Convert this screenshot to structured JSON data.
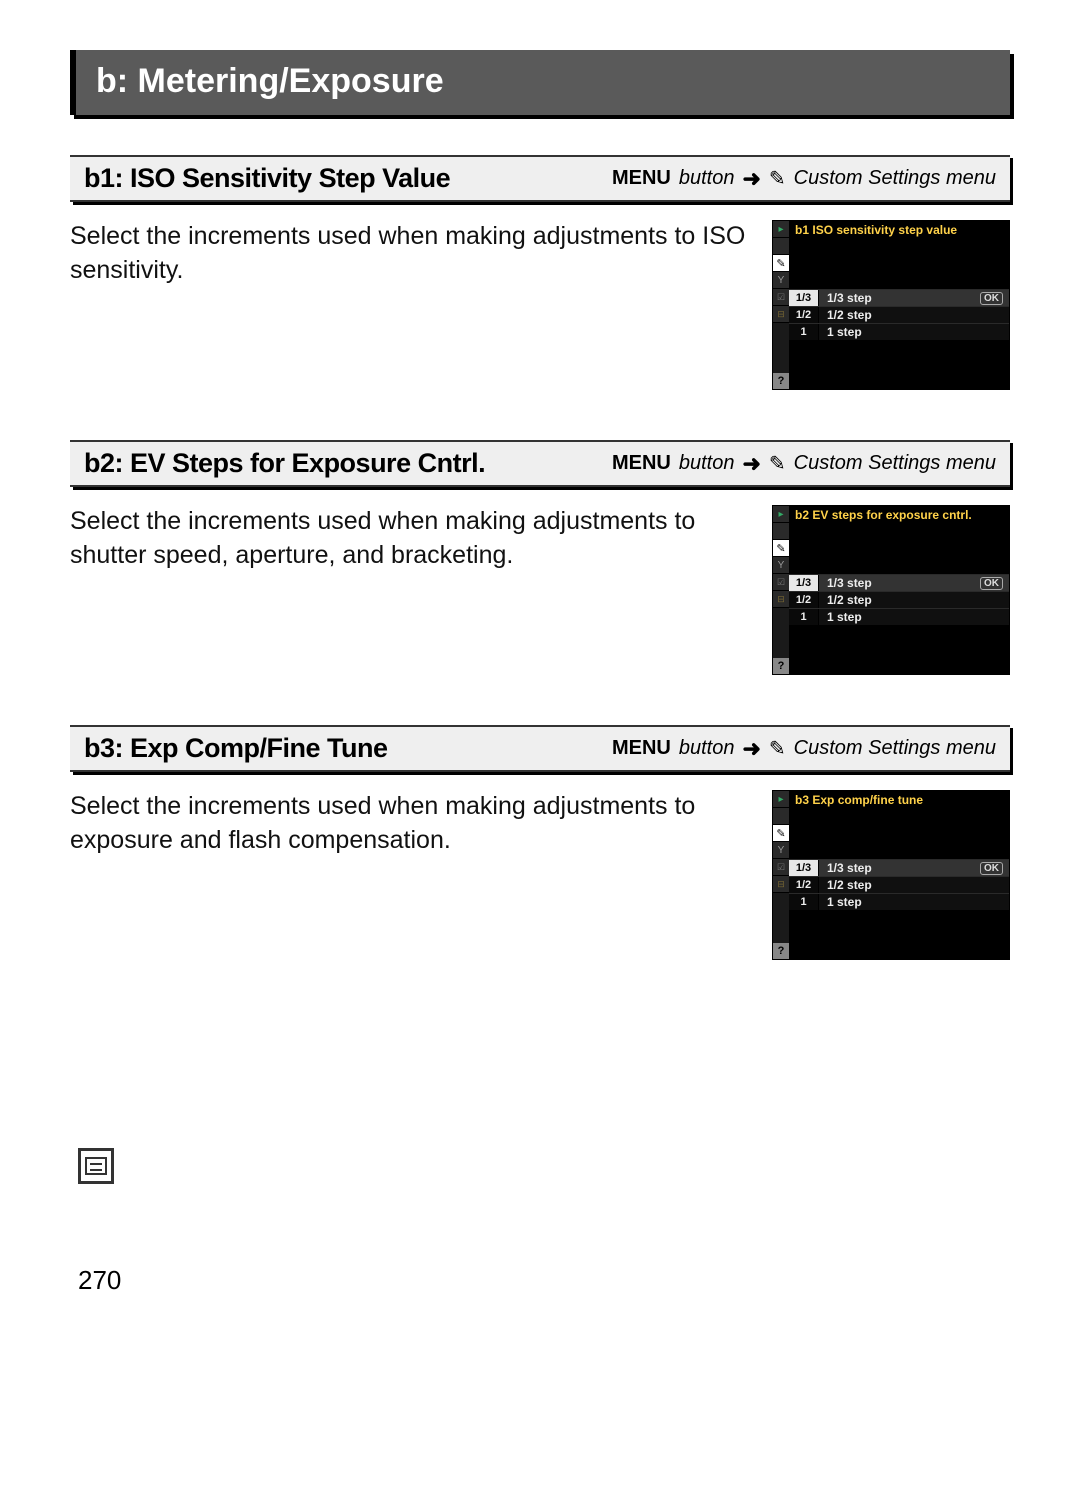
{
  "section": {
    "title": "b: Metering/Exposure"
  },
  "nav": {
    "menu": "MENU",
    "button_word": "button",
    "arrow": "➜",
    "pencil": "✎",
    "dest": "Custom Settings menu"
  },
  "items": [
    {
      "title": "b1: ISO Sensitivity Step Value",
      "desc": "Select the increments used when making adjustments to ISO sensitivity.",
      "lcd": {
        "heading_code": "b1",
        "heading_text": "ISO sensitivity step value",
        "rows": [
          {
            "frac": "1/3",
            "label": "1/3 step",
            "selected": true,
            "ok": "OK"
          },
          {
            "frac": "1/2",
            "label": "1/2 step",
            "selected": false
          },
          {
            "frac": "1",
            "label": "1 step",
            "selected": false
          }
        ]
      }
    },
    {
      "title": "b2: EV Steps for Exposure Cntrl.",
      "desc": "Select the increments used when making adjustments to shutter speed, aperture, and bracketing.",
      "lcd": {
        "heading_code": "b2",
        "heading_text": "EV steps for exposure cntrl.",
        "rows": [
          {
            "frac": "1/3",
            "label": "1/3 step",
            "selected": true,
            "ok": "OK"
          },
          {
            "frac": "1/2",
            "label": "1/2 step",
            "selected": false
          },
          {
            "frac": "1",
            "label": "1 step",
            "selected": false
          }
        ]
      }
    },
    {
      "title": "b3: Exp Comp/Fine Tune",
      "desc": "Select the increments used when making adjustments to exposure and flash compensation.",
      "lcd": {
        "heading_code": "b3",
        "heading_text": "Exp comp/fine tune",
        "rows": [
          {
            "frac": "1/3",
            "label": "1/3 step",
            "selected": true,
            "ok": "OK"
          },
          {
            "frac": "1/2",
            "label": "1/2 step",
            "selected": false
          },
          {
            "frac": "1",
            "label": "1 step",
            "selected": false
          }
        ]
      }
    }
  ],
  "page_number": "270",
  "help_glyph": "?"
}
